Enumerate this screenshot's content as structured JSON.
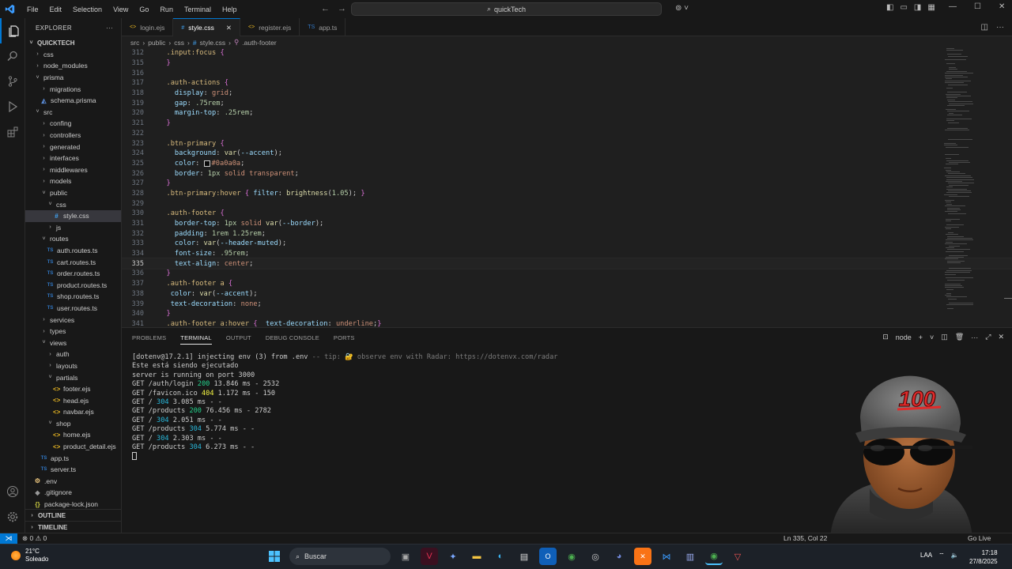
{
  "menu": [
    "File",
    "Edit",
    "Selection",
    "View",
    "Go",
    "Run",
    "Terminal",
    "Help"
  ],
  "command_center": {
    "text": "quickTech"
  },
  "explorer": {
    "header": "EXPLORER",
    "root": "QUICKTECH",
    "items": [
      {
        "label": "css",
        "depth": 1,
        "kind": "folder",
        "open": false
      },
      {
        "label": "node_modules",
        "depth": 1,
        "kind": "folder",
        "open": false
      },
      {
        "label": "prisma",
        "depth": 1,
        "kind": "folder",
        "open": true
      },
      {
        "label": "migrations",
        "depth": 2,
        "kind": "folder",
        "open": false
      },
      {
        "label": "schema.prisma",
        "depth": 2,
        "kind": "prisma"
      },
      {
        "label": "src",
        "depth": 1,
        "kind": "folder",
        "open": true
      },
      {
        "label": "confing",
        "depth": 2,
        "kind": "folder",
        "open": false
      },
      {
        "label": "controllers",
        "depth": 2,
        "kind": "folder",
        "open": false
      },
      {
        "label": "generated",
        "depth": 2,
        "kind": "folder",
        "open": false
      },
      {
        "label": "interfaces",
        "depth": 2,
        "kind": "folder",
        "open": false
      },
      {
        "label": "middlewares",
        "depth": 2,
        "kind": "folder",
        "open": false
      },
      {
        "label": "models",
        "depth": 2,
        "kind": "folder",
        "open": false
      },
      {
        "label": "public",
        "depth": 2,
        "kind": "folder",
        "open": true
      },
      {
        "label": "css",
        "depth": 3,
        "kind": "folder",
        "open": true
      },
      {
        "label": "style.css",
        "depth": 4,
        "kind": "css",
        "selected": true
      },
      {
        "label": "js",
        "depth": 3,
        "kind": "folder",
        "open": false
      },
      {
        "label": "routes",
        "depth": 2,
        "kind": "folder",
        "open": true
      },
      {
        "label": "auth.routes.ts",
        "depth": 3,
        "kind": "ts"
      },
      {
        "label": "cart.routes.ts",
        "depth": 3,
        "kind": "ts"
      },
      {
        "label": "order.routes.ts",
        "depth": 3,
        "kind": "ts"
      },
      {
        "label": "product.routes.ts",
        "depth": 3,
        "kind": "ts"
      },
      {
        "label": "shop.routes.ts",
        "depth": 3,
        "kind": "ts"
      },
      {
        "label": "user.routes.ts",
        "depth": 3,
        "kind": "ts"
      },
      {
        "label": "services",
        "depth": 2,
        "kind": "folder",
        "open": false
      },
      {
        "label": "types",
        "depth": 2,
        "kind": "folder",
        "open": false
      },
      {
        "label": "views",
        "depth": 2,
        "kind": "folder",
        "open": true
      },
      {
        "label": "auth",
        "depth": 3,
        "kind": "folder",
        "open": false
      },
      {
        "label": "layouts",
        "depth": 3,
        "kind": "folder",
        "open": false
      },
      {
        "label": "partials",
        "depth": 3,
        "kind": "folder",
        "open": true
      },
      {
        "label": "footer.ejs",
        "depth": 4,
        "kind": "ejs"
      },
      {
        "label": "head.ejs",
        "depth": 4,
        "kind": "ejs"
      },
      {
        "label": "navbar.ejs",
        "depth": 4,
        "kind": "ejs"
      },
      {
        "label": "shop",
        "depth": 3,
        "kind": "folder",
        "open": true
      },
      {
        "label": "home.ejs",
        "depth": 4,
        "kind": "ejs"
      },
      {
        "label": "product_detail.ejs",
        "depth": 4,
        "kind": "ejs"
      },
      {
        "label": "app.ts",
        "depth": 2,
        "kind": "ts"
      },
      {
        "label": "server.ts",
        "depth": 2,
        "kind": "ts"
      },
      {
        "label": ".env",
        "depth": 1,
        "kind": "env"
      },
      {
        "label": ".gitignore",
        "depth": 1,
        "kind": "git"
      },
      {
        "label": "package-lock.json",
        "depth": 1,
        "kind": "json"
      }
    ],
    "outline": "OUTLINE",
    "timeline": "TIMELINE"
  },
  "tabs": [
    {
      "label": "login.ejs",
      "icon": "<>",
      "active": false
    },
    {
      "label": "style.css",
      "icon": "#",
      "active": true
    },
    {
      "label": "register.ejs",
      "icon": "<>",
      "active": false
    },
    {
      "label": "app.ts",
      "icon": "TS",
      "active": false
    }
  ],
  "breadcrumb": [
    "src",
    "public",
    "css",
    "style.css",
    ".auth-footer"
  ],
  "code": [
    {
      "n": "312",
      "t": [
        [
          "c-sel",
          "  .input:focus "
        ],
        [
          "c-br",
          "{"
        ]
      ]
    },
    {
      "n": "315",
      "t": [
        [
          "c-br",
          "  }"
        ]
      ]
    },
    {
      "n": "316",
      "t": []
    },
    {
      "n": "317",
      "t": [
        [
          "c-sel",
          "  .auth-actions "
        ],
        [
          "c-br",
          "{"
        ]
      ]
    },
    {
      "n": "318",
      "t": [
        [
          "c-prop",
          "    display"
        ],
        [
          "c-pun",
          ": "
        ],
        [
          "c-val",
          "grid"
        ],
        [
          "c-pun",
          ";"
        ]
      ]
    },
    {
      "n": "319",
      "t": [
        [
          "c-prop",
          "    gap"
        ],
        [
          "c-pun",
          ": "
        ],
        [
          "c-num",
          ".75rem"
        ],
        [
          "c-pun",
          ";"
        ]
      ]
    },
    {
      "n": "320",
      "t": [
        [
          "c-prop",
          "    margin-top"
        ],
        [
          "c-pun",
          ": "
        ],
        [
          "c-num",
          ".25rem"
        ],
        [
          "c-pun",
          ";"
        ]
      ]
    },
    {
      "n": "321",
      "t": [
        [
          "c-br",
          "  }"
        ]
      ]
    },
    {
      "n": "322",
      "t": []
    },
    {
      "n": "323",
      "t": [
        [
          "c-sel",
          "  .btn-primary "
        ],
        [
          "c-br",
          "{"
        ]
      ]
    },
    {
      "n": "324",
      "t": [
        [
          "c-prop",
          "    background"
        ],
        [
          "c-pun",
          ": "
        ],
        [
          "c-fn",
          "var"
        ],
        [
          "c-pun",
          "("
        ],
        [
          "c-var",
          "--accent"
        ],
        [
          "c-pun",
          ");"
        ]
      ]
    },
    {
      "n": "325",
      "t": [
        [
          "c-prop",
          "    color"
        ],
        [
          "c-pun",
          ": "
        ],
        [
          "swatch",
          ""
        ],
        [
          "c-val",
          "#0a0a0a"
        ],
        [
          "c-pun",
          ";"
        ]
      ]
    },
    {
      "n": "326",
      "t": [
        [
          "c-prop",
          "    border"
        ],
        [
          "c-pun",
          ": "
        ],
        [
          "c-num",
          "1px"
        ],
        [
          "c-val",
          " solid transparent"
        ],
        [
          "c-pun",
          ";"
        ]
      ]
    },
    {
      "n": "327",
      "t": [
        [
          "c-br",
          "  }"
        ]
      ]
    },
    {
      "n": "328",
      "t": [
        [
          "c-sel",
          "  .btn-primary:hover "
        ],
        [
          "c-br",
          "{ "
        ],
        [
          "c-prop",
          "filter"
        ],
        [
          "c-pun",
          ": "
        ],
        [
          "c-fn",
          "brightness"
        ],
        [
          "c-pun",
          "("
        ],
        [
          "c-num",
          "1.05"
        ],
        [
          "c-pun",
          "); "
        ],
        [
          "c-br",
          "}"
        ]
      ]
    },
    {
      "n": "329",
      "t": []
    },
    {
      "n": "330",
      "t": [
        [
          "c-sel",
          "  .auth-footer "
        ],
        [
          "c-br",
          "{"
        ]
      ]
    },
    {
      "n": "331",
      "t": [
        [
          "c-prop",
          "    border-top"
        ],
        [
          "c-pun",
          ": "
        ],
        [
          "c-num",
          "1px"
        ],
        [
          "c-val",
          " solid "
        ],
        [
          "c-fn",
          "var"
        ],
        [
          "c-pun",
          "("
        ],
        [
          "c-var",
          "--border"
        ],
        [
          "c-pun",
          ");"
        ]
      ]
    },
    {
      "n": "332",
      "t": [
        [
          "c-prop",
          "    padding"
        ],
        [
          "c-pun",
          ": "
        ],
        [
          "c-num",
          "1rem 1.25rem"
        ],
        [
          "c-pun",
          ";"
        ]
      ]
    },
    {
      "n": "333",
      "t": [
        [
          "c-prop",
          "    color"
        ],
        [
          "c-pun",
          ": "
        ],
        [
          "c-fn",
          "var"
        ],
        [
          "c-pun",
          "("
        ],
        [
          "c-var",
          "--header-muted"
        ],
        [
          "c-pun",
          ");"
        ]
      ]
    },
    {
      "n": "334",
      "t": [
        [
          "c-prop",
          "    font-size"
        ],
        [
          "c-pun",
          ": "
        ],
        [
          "c-num",
          ".95rem"
        ],
        [
          "c-pun",
          ";"
        ]
      ]
    },
    {
      "n": "335",
      "t": [
        [
          "c-prop",
          "    text-align"
        ],
        [
          "c-pun",
          ": "
        ],
        [
          "c-val",
          "center"
        ],
        [
          "c-pun",
          ";"
        ]
      ],
      "current": true
    },
    {
      "n": "336",
      "t": [
        [
          "c-br",
          "  }"
        ]
      ]
    },
    {
      "n": "337",
      "t": [
        [
          "c-sel",
          "  .auth-footer a "
        ],
        [
          "c-br",
          "{"
        ]
      ]
    },
    {
      "n": "338",
      "t": [
        [
          "c-prop",
          "   color"
        ],
        [
          "c-pun",
          ": "
        ],
        [
          "c-fn",
          "var"
        ],
        [
          "c-pun",
          "("
        ],
        [
          "c-var",
          "--accent"
        ],
        [
          "c-pun",
          ");"
        ]
      ]
    },
    {
      "n": "339",
      "t": [
        [
          "c-prop",
          "   text-decoration"
        ],
        [
          "c-pun",
          ": "
        ],
        [
          "c-val",
          "none"
        ],
        [
          "c-pun",
          ";"
        ]
      ]
    },
    {
      "n": "340",
      "t": [
        [
          "c-br",
          "  }"
        ]
      ]
    },
    {
      "n": "341",
      "t": [
        [
          "c-sel",
          "  .auth-footer a:hover "
        ],
        [
          "c-br",
          "{  "
        ],
        [
          "c-prop",
          "text-decoration"
        ],
        [
          "c-pun",
          ": "
        ],
        [
          "c-val",
          "underline"
        ],
        [
          "c-pun",
          ";"
        ],
        [
          "c-br",
          "}"
        ]
      ]
    }
  ],
  "panel": {
    "tabs": [
      "PROBLEMS",
      "TERMINAL",
      "OUTPUT",
      "DEBUG CONSOLE",
      "PORTS"
    ],
    "active_tab": "TERMINAL",
    "shell": "node"
  },
  "terminal": [
    [
      [
        "",
        "[dotenv@17.2.1] injecting env (3) from .env "
      ],
      [
        "t-muted",
        "-- tip: 🔐 observe env with Radar: https://dotenvx.com/radar"
      ]
    ],
    [
      [
        "",
        "Este está siendo ejecutado"
      ]
    ],
    [
      [
        "",
        "server is running on port 3000"
      ]
    ],
    [
      [
        "",
        "GET /auth/login "
      ],
      [
        "t-green",
        "200"
      ],
      [
        "",
        " 13.846 ms - 2532"
      ]
    ],
    [
      [
        "",
        "GET /favicon.ico "
      ],
      [
        "t-yellow",
        "404"
      ],
      [
        "",
        " 1.172 ms - 150"
      ]
    ],
    [
      [
        "",
        "GET / "
      ],
      [
        "t-cyan",
        "304"
      ],
      [
        "",
        " 3.085 ms - -"
      ]
    ],
    [
      [
        "",
        "GET /products "
      ],
      [
        "t-green",
        "200"
      ],
      [
        "",
        " 76.456 ms - 2782"
      ]
    ],
    [
      [
        "",
        "GET / "
      ],
      [
        "t-cyan",
        "304"
      ],
      [
        "",
        " 2.051 ms - -"
      ]
    ],
    [
      [
        "",
        "GET /products "
      ],
      [
        "t-cyan",
        "304"
      ],
      [
        "",
        " 5.774 ms - -"
      ]
    ],
    [
      [
        "",
        "GET / "
      ],
      [
        "t-cyan",
        "304"
      ],
      [
        "",
        " 2.303 ms - -"
      ]
    ],
    [
      [
        "",
        "GET /products "
      ],
      [
        "t-cyan",
        "304"
      ],
      [
        "",
        " 6.273 ms - -"
      ]
    ]
  ],
  "status": {
    "errors": "⊗ 0 ⚠ 0",
    "position": "Ln 335, Col 22",
    "golive": "Go Live"
  },
  "taskbar": {
    "temp": "21°C",
    "condition": "Soleado",
    "search": "Buscar",
    "lang": "LAA",
    "time": "17:18",
    "date": "27/8/2025"
  },
  "colors": {
    "accent": "#0078d4",
    "editor_bg": "#1f1f1f",
    "panel_bg": "#181818"
  },
  "avatar": {
    "cap_text": "100"
  }
}
